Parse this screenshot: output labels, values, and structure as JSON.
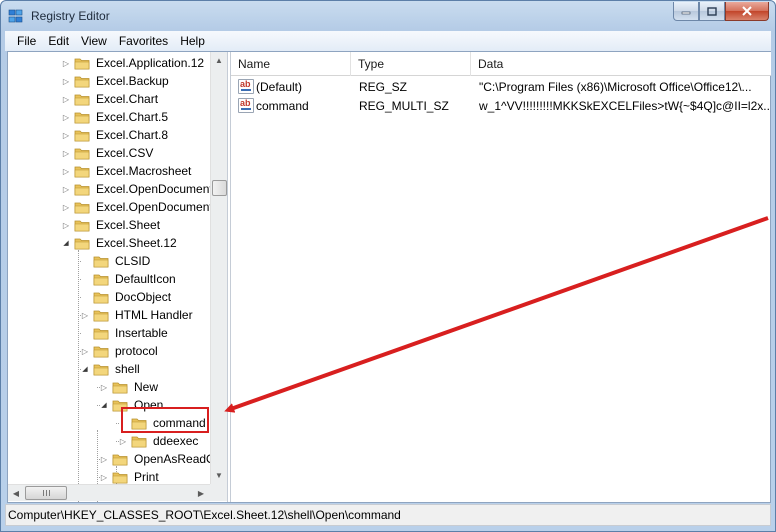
{
  "window": {
    "title": "Registry Editor"
  },
  "menu": [
    "File",
    "Edit",
    "View",
    "Favorites",
    "Help"
  ],
  "tree": {
    "items": [
      {
        "label": "Excel.Application.12",
        "expander": "collapsed"
      },
      {
        "label": "Excel.Backup",
        "expander": "collapsed"
      },
      {
        "label": "Excel.Chart",
        "expander": "collapsed"
      },
      {
        "label": "Excel.Chart.5",
        "expander": "collapsed"
      },
      {
        "label": "Excel.Chart.8",
        "expander": "collapsed"
      },
      {
        "label": "Excel.CSV",
        "expander": "collapsed"
      },
      {
        "label": "Excel.Macrosheet",
        "expander": "collapsed"
      },
      {
        "label": "Excel.OpenDocument",
        "expander": "collapsed"
      },
      {
        "label": "Excel.OpenDocument",
        "expander": "collapsed"
      },
      {
        "label": "Excel.Sheet",
        "expander": "collapsed"
      },
      {
        "label": "Excel.Sheet.12",
        "expander": "expanded"
      },
      {
        "label": "CLSID",
        "expander": "none"
      },
      {
        "label": "DefaultIcon",
        "expander": "none"
      },
      {
        "label": "DocObject",
        "expander": "none"
      },
      {
        "label": "HTML Handler",
        "expander": "collapsed"
      },
      {
        "label": "Insertable",
        "expander": "none"
      },
      {
        "label": "protocol",
        "expander": "collapsed"
      },
      {
        "label": "shell",
        "expander": "expanded"
      },
      {
        "label": "New",
        "expander": "collapsed"
      },
      {
        "label": "Open",
        "expander": "expanded"
      },
      {
        "label": "command",
        "expander": "none",
        "selected": true
      },
      {
        "label": "ddeexec",
        "expander": "collapsed"
      },
      {
        "label": "OpenAsReadO",
        "expander": "collapsed"
      },
      {
        "label": "Print",
        "expander": "collapsed"
      }
    ]
  },
  "list": {
    "columns": [
      "Name",
      "Type",
      "Data"
    ],
    "rows": [
      {
        "icon": "string-value-icon",
        "name": "(Default)",
        "type": "REG_SZ",
        "data": "\"C:\\Program Files (x86)\\Microsoft Office\\Office12\\..."
      },
      {
        "icon": "string-value-icon",
        "name": "command",
        "type": "REG_MULTI_SZ",
        "data": "w_1^VV!!!!!!!!!MKKSkEXCELFiles>tW{~$4Q]c@II=l2x..."
      }
    ]
  },
  "statusbar": {
    "path": "Computer\\HKEY_CLASSES_ROOT\\Excel.Sheet.12\\shell\\Open\\command"
  },
  "colors": {
    "annotation": "#d81f1f",
    "folder": "#e8c25a"
  }
}
